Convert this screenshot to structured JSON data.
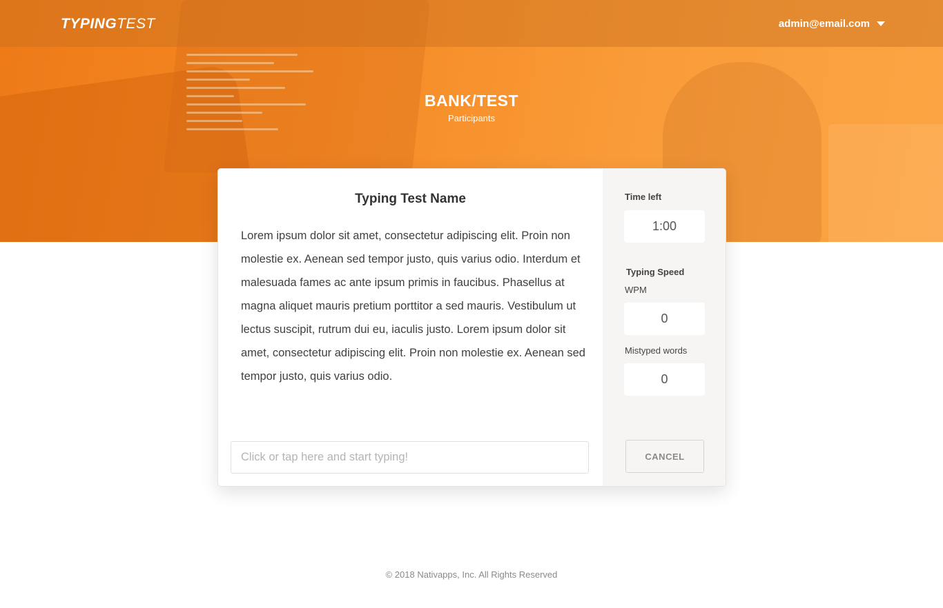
{
  "header": {
    "logo_bold": "TYPING",
    "logo_light": "TEST",
    "user_email": "admin@email.com"
  },
  "hero": {
    "title": "BANK/TEST",
    "subtitle": "Participants"
  },
  "test": {
    "name": "Typing Test Name",
    "passage": "Lorem ipsum dolor sit amet, consectetur adipiscing elit. Proin non molestie ex. Aenean sed tempor justo, quis varius odio. Interdum et malesuada fames ac ante ipsum primis in faucibus. Phasellus at magna aliquet mauris pretium porttitor a sed mauris. Vestibulum ut lectus suscipit, rutrum dui eu, iaculis justo. Lorem ipsum dolor sit amet, consectetur adipiscing elit. Proin non molestie ex. Aenean sed tempor justo, quis varius odio.",
    "input_placeholder": "Click or tap here and start typing!",
    "input_value": ""
  },
  "stats": {
    "time_left_label": "Time left",
    "time_left_value": "1:00",
    "typing_speed_label": "Typing Speed",
    "wpm_label": "WPM",
    "wpm_value": "0",
    "mistyped_label": "Mistyped words",
    "mistyped_value": "0",
    "cancel_label": "CANCEL"
  },
  "footer": {
    "text": "© 2018  Nativapps, Inc. All Rights Reserved"
  },
  "colors": {
    "brand_orange": "#f58a24",
    "panel_bg": "#f6f5f4"
  },
  "icons": {
    "user_menu_caret": "caret-down-icon"
  }
}
